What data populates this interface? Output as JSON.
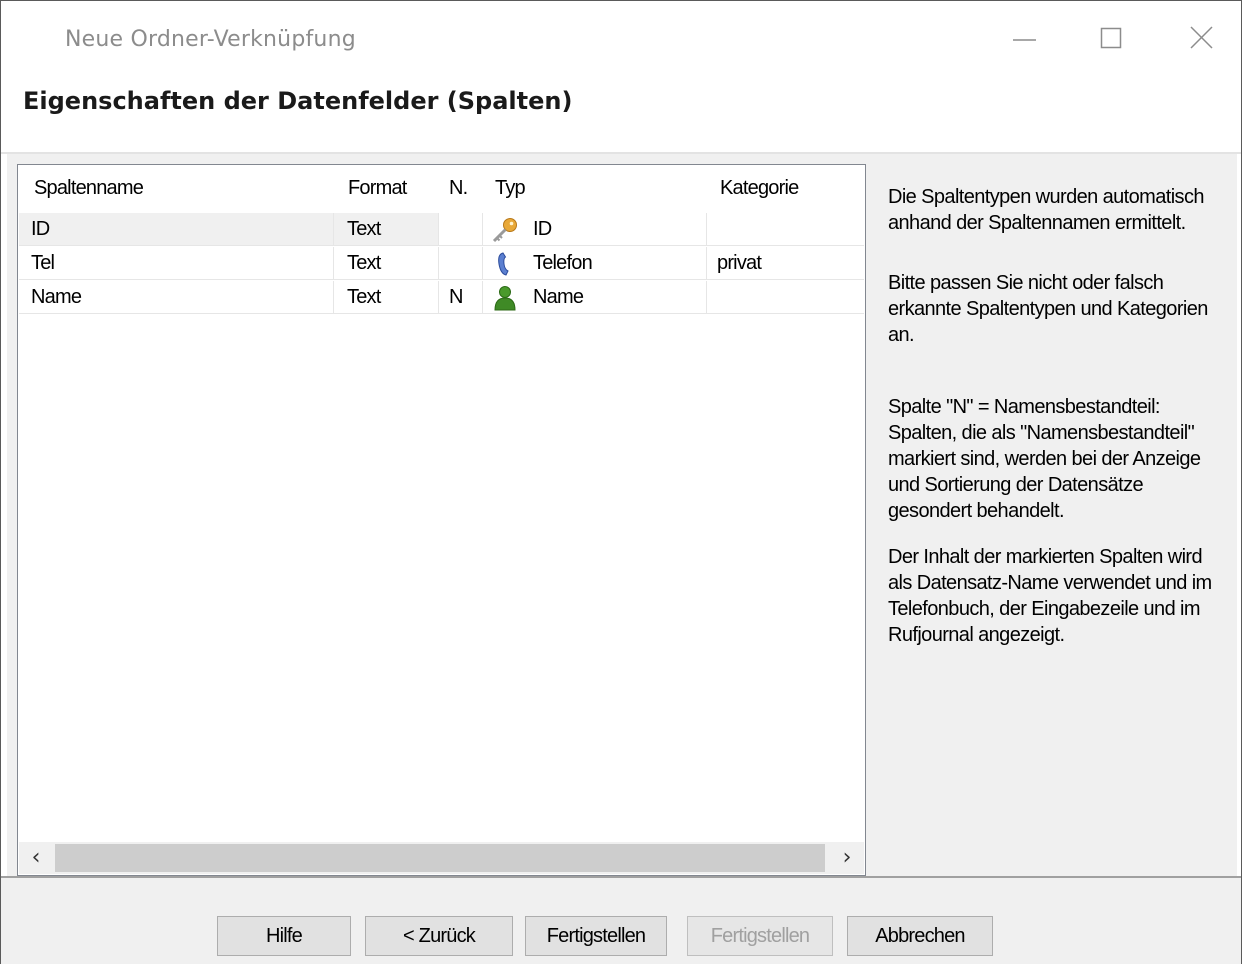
{
  "window": {
    "title": "Neue Ordner-Verknüpfung"
  },
  "page": {
    "heading": "Eigenschaften der Datenfelder (Spalten)"
  },
  "table": {
    "headers": [
      "Spaltenname",
      "Format",
      "N.",
      "Typ",
      "Kategorie"
    ],
    "rows": [
      {
        "name": "ID",
        "format": "Text",
        "n": "",
        "type": "ID",
        "type_icon": "key-icon",
        "category": ""
      },
      {
        "name": "Tel",
        "format": "Text",
        "n": "",
        "type": "Telefon",
        "type_icon": "phone-icon",
        "category": "privat"
      },
      {
        "name": "Name",
        "format": "Text",
        "n": "N",
        "type": "Name",
        "type_icon": "person-icon",
        "category": ""
      }
    ]
  },
  "help": {
    "p1": "Die Spaltentypen wurden automatisch anhand der Spaltennamen ermittelt.",
    "p2": "Bitte passen Sie nicht oder falsch erkannte Spaltentypen und Kategorien an.",
    "p3": "Spalte \"N\" = Namensbestandteil: Spalten, die als \"Namensbestandteil\" markiert sind, werden bei der Anzeige und Sortierung der Datensätze gesondert behandelt.",
    "p4": "Der Inhalt der markierten Spalten wird als Datensatz-Name verwendet und im Telefonbuch, der Eingabezeile und im Rufjournal angezeigt."
  },
  "buttons": {
    "help": "Hilfe",
    "back": "< Zurück",
    "finish": "Fertigstellen",
    "finish_disabled": "Fertigstellen",
    "cancel": "Abbrechen"
  }
}
